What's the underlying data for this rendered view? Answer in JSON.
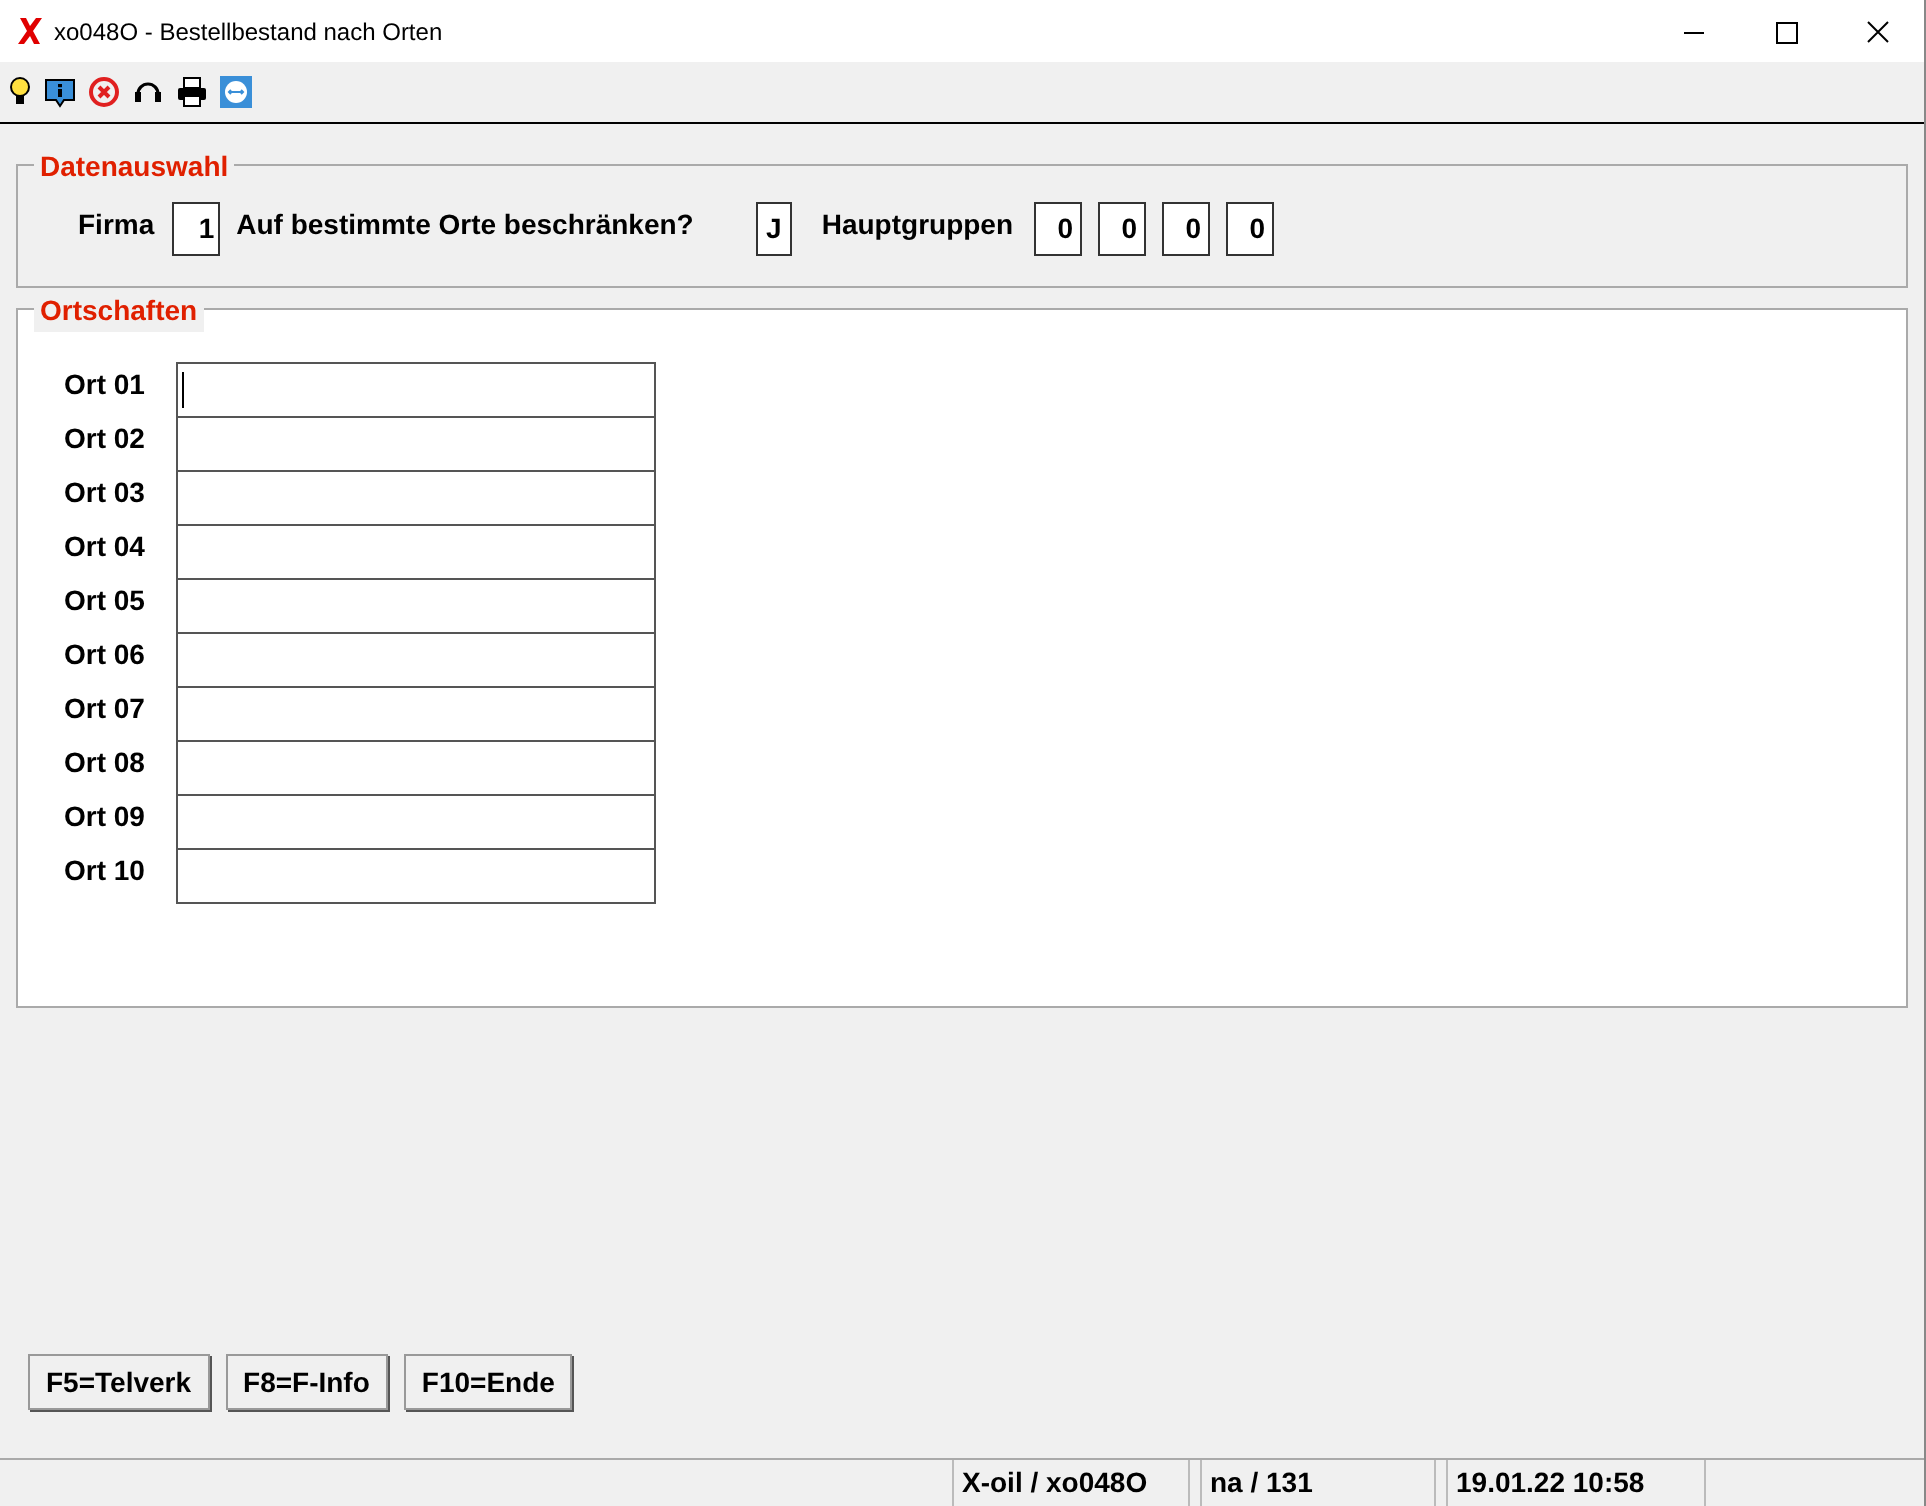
{
  "window": {
    "title": "xo048O - Bestellbestand nach Orten"
  },
  "toolbar": [
    {
      "kind": "bulb"
    },
    {
      "kind": "info"
    },
    {
      "kind": "cancel"
    },
    {
      "kind": "headset"
    },
    {
      "kind": "printer"
    },
    {
      "kind": "remote"
    }
  ],
  "datenauswahl": {
    "title": "Datenauswahl",
    "firma_label": "Firma",
    "firma": "1",
    "orte_label": "Auf bestimmte Orte beschränken?",
    "orte": "J",
    "hauptgruppen_label": "Hauptgruppen",
    "hauptgruppen": [
      "0",
      "0",
      "0",
      "0"
    ]
  },
  "ortschaften": {
    "title": "Ortschaften",
    "rows": [
      {
        "label": "Ort 01",
        "focused": true
      },
      {
        "label": "Ort 02",
        "focused": false
      },
      {
        "label": "Ort 03",
        "focused": false
      },
      {
        "label": "Ort 04",
        "focused": false
      },
      {
        "label": "Ort 05",
        "focused": false
      },
      {
        "label": "Ort 06",
        "focused": false
      },
      {
        "label": "Ort 07",
        "focused": false
      },
      {
        "label": "Ort 08",
        "focused": false
      },
      {
        "label": "Ort 09",
        "focused": false
      },
      {
        "label": "Ort 10",
        "focused": false
      }
    ]
  },
  "buttons": [
    "F5=Telverk",
    "F8=F-Info",
    "F10=Ende"
  ],
  "status_bar": [
    "X-oil / xo048O",
    "na / 131",
    "19.01.22 10:58"
  ]
}
